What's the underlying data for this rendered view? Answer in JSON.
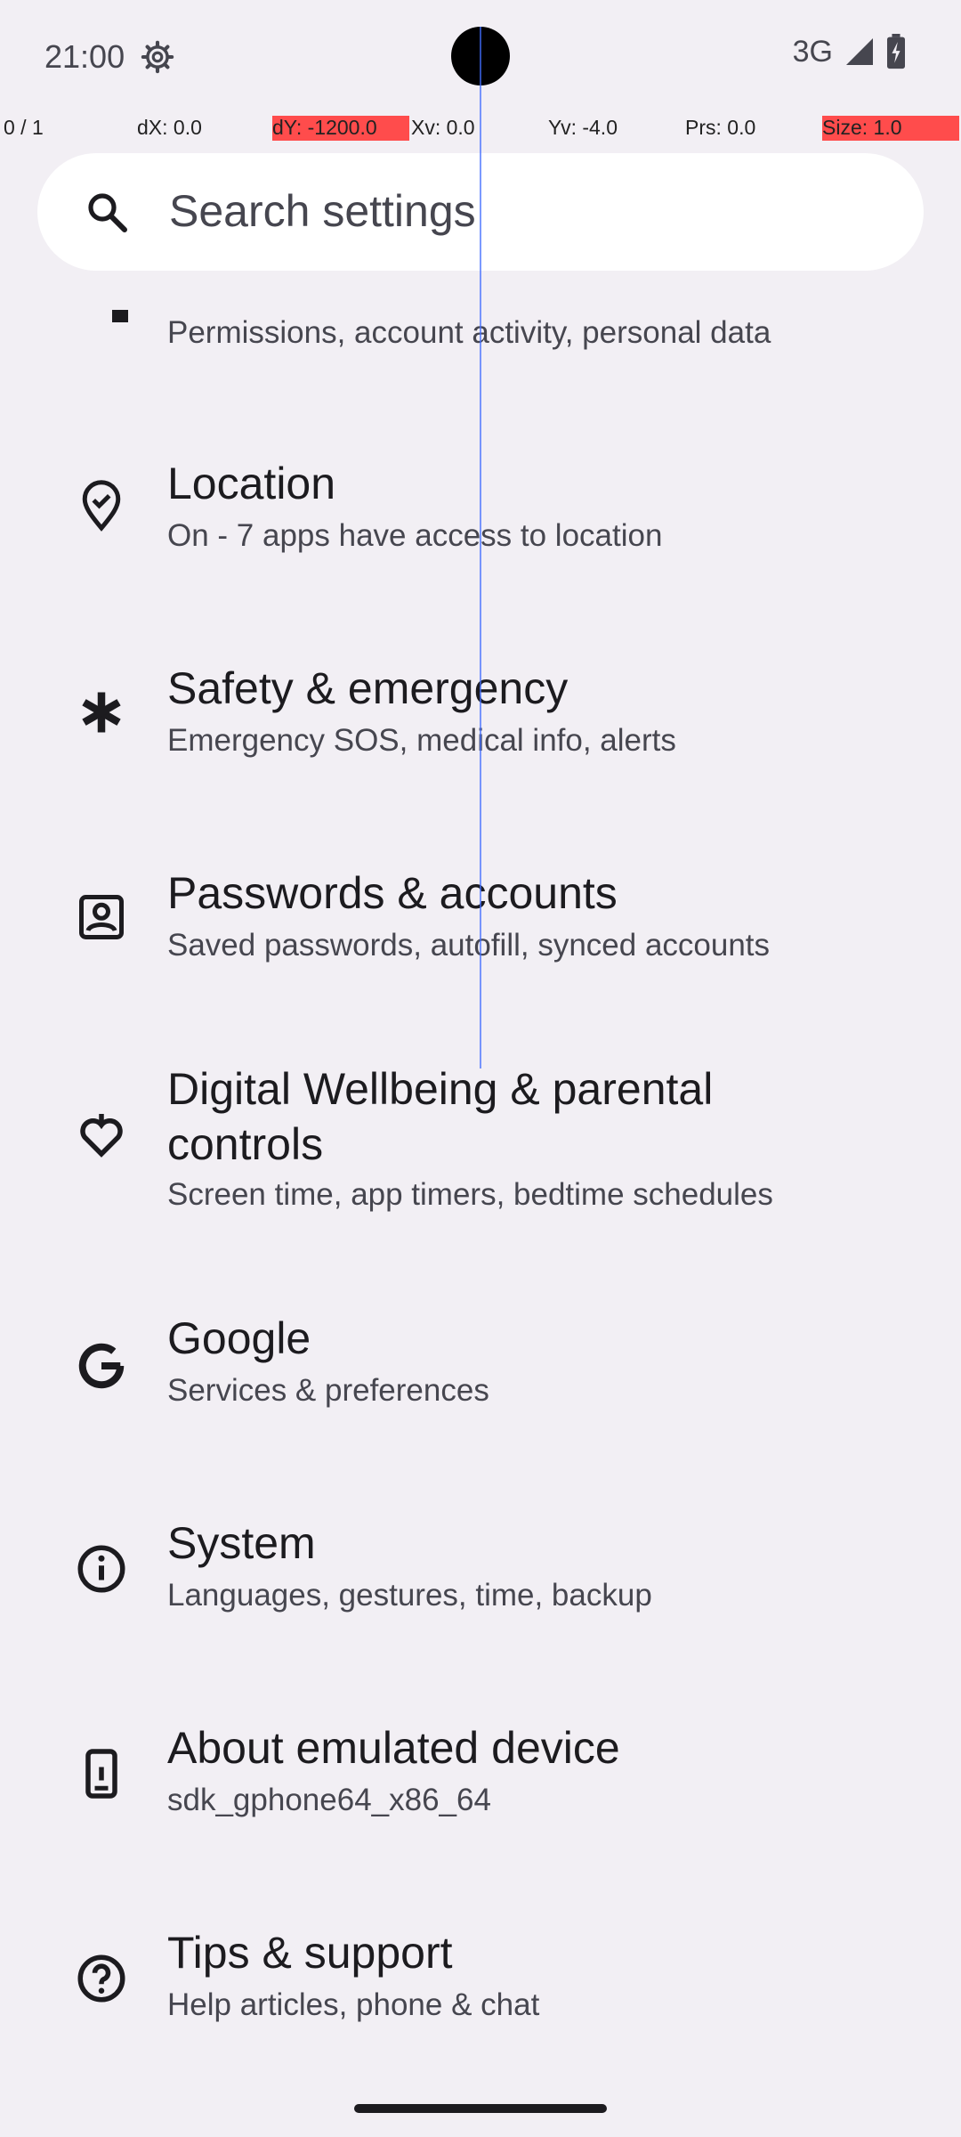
{
  "status_bar": {
    "time": "21:00",
    "network": "3G"
  },
  "pointer_overlay": {
    "pointer": "0 / 1",
    "dx": "dX: 0.0",
    "dy": "dY: -1200.0",
    "xv": "Xv: 0.0",
    "yv": "Yv: -4.0",
    "prs": "Prs: 0.0",
    "size": "Size: 1.0"
  },
  "search": {
    "placeholder": "Search settings"
  },
  "settings": {
    "privacy": {
      "summary": "Permissions, account activity, personal data"
    },
    "location": {
      "title": "Location",
      "summary": "On - 7 apps have access to location"
    },
    "safety": {
      "title": "Safety & emergency",
      "summary": "Emergency SOS, medical info, alerts"
    },
    "passwords": {
      "title": "Passwords & accounts",
      "summary": "Saved passwords, autofill, synced accounts"
    },
    "wellbeing": {
      "title_line1": "Digital Wellbeing & parental",
      "title_line2": "controls",
      "summary": "Screen time, app timers, bedtime schedules"
    },
    "google": {
      "title": "Google",
      "summary": "Services & preferences"
    },
    "system": {
      "title": "System",
      "summary": "Languages, gestures, time, backup"
    },
    "about": {
      "title": "About emulated device",
      "summary": "sdk_gphone64_x86_64"
    },
    "tips": {
      "title": "Tips & support",
      "summary": "Help articles, phone & chat"
    }
  },
  "colors": {
    "background": "#f2eff4",
    "overlay_highlight": "#ff4c4c"
  },
  "icons": [
    "gear-icon",
    "signal-icon",
    "battery-icon",
    "search-icon",
    "privacy-icon",
    "location-icon",
    "emergency-icon",
    "accounts-icon",
    "wellbeing-icon",
    "google-icon",
    "system-icon",
    "device-icon",
    "help-icon"
  ]
}
